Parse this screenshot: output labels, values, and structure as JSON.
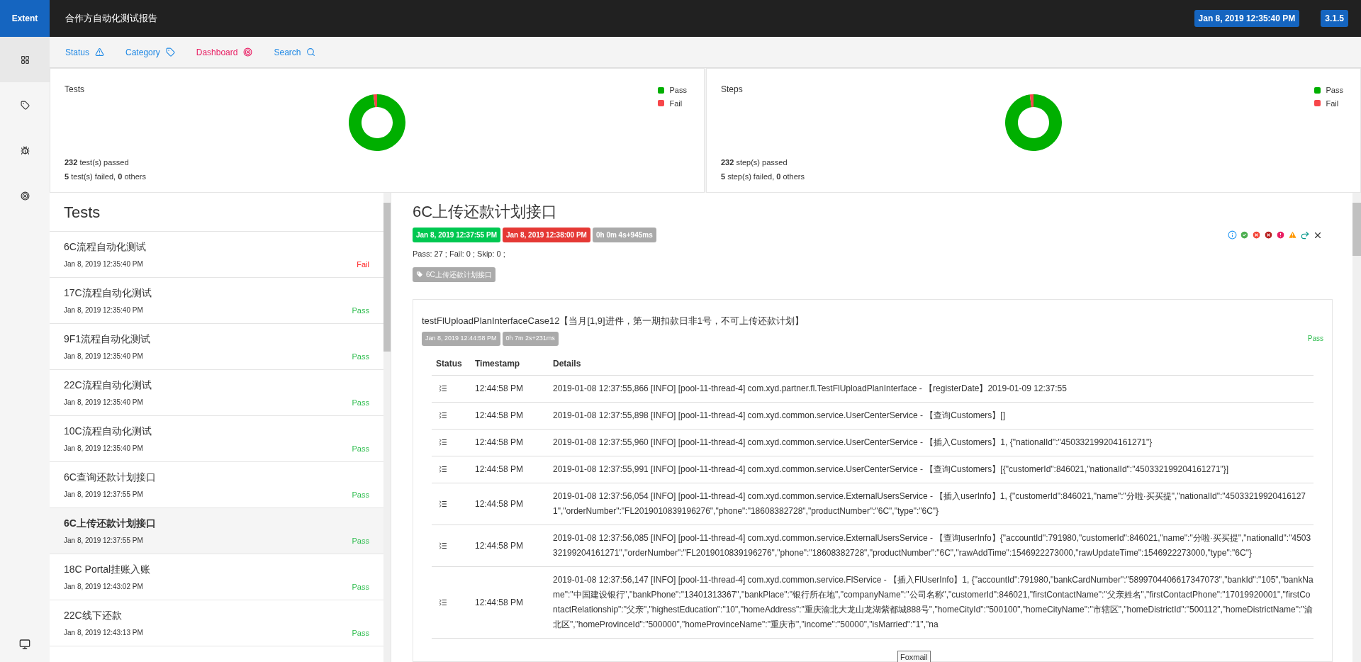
{
  "brand": "Extent",
  "report_title": "合作方自动化测试报告",
  "header_badges": [
    {
      "text": "Jan 8, 2019 12:35:40 PM"
    },
    {
      "text": "3.1.5"
    }
  ],
  "sidebar": {
    "items": [
      {
        "selected": true
      },
      {
        "selected": false
      },
      {
        "selected": false
      },
      {
        "selected": false
      }
    ]
  },
  "nav": [
    {
      "label": "Status",
      "selected": false
    },
    {
      "label": "Category",
      "selected": false
    },
    {
      "label": "Dashboard",
      "selected": true
    },
    {
      "label": "Search",
      "selected": false
    }
  ],
  "summary_cards": [
    {
      "title": "Tests",
      "legend": [
        {
          "label": "Pass",
          "color": "#00af00"
        },
        {
          "label": "Fail",
          "color": "#f7464a"
        }
      ],
      "lines": [
        "**232** test(s) passed",
        "**5** test(s) failed, **0** others"
      ]
    },
    {
      "title": "Steps",
      "legend": [
        {
          "label": "Pass",
          "color": "#00af00"
        },
        {
          "label": "Fail",
          "color": "#f7464a"
        }
      ],
      "lines": [
        "**232** step(s) passed",
        "**5** step(s) failed, **0** others"
      ]
    }
  ],
  "tests": {
    "title": "Tests",
    "items": [
      {
        "name": "6C流程自动化测试",
        "time": "Jan 8, 2019 12:35:40 PM",
        "status": "Fail",
        "kind": "fail",
        "selected": false
      },
      {
        "name": "17C流程自动化测试",
        "time": "Jan 8, 2019 12:35:40 PM",
        "status": "Pass",
        "kind": "pass",
        "selected": false
      },
      {
        "name": "9F1流程自动化测试",
        "time": "Jan 8, 2019 12:35:40 PM",
        "status": "Pass",
        "kind": "pass",
        "selected": false
      },
      {
        "name": "22C流程自动化测试",
        "time": "Jan 8, 2019 12:35:40 PM",
        "status": "Pass",
        "kind": "pass",
        "selected": false
      },
      {
        "name": "10C流程自动化测试",
        "time": "Jan 8, 2019 12:35:40 PM",
        "status": "Pass",
        "kind": "pass",
        "selected": false
      },
      {
        "name": "6C查询还款计划接口",
        "time": "Jan 8, 2019 12:37:55 PM",
        "status": "Pass",
        "kind": "pass",
        "selected": false
      },
      {
        "name": "6C上传还款计划接口",
        "time": "Jan 8, 2019 12:37:55 PM",
        "status": "Pass",
        "kind": "pass",
        "selected": true
      },
      {
        "name": "18C Portal挂账入账",
        "time": "Jan 8, 2019 12:43:02 PM",
        "status": "Pass",
        "kind": "pass",
        "selected": false
      },
      {
        "name": "22C线下还款",
        "time": "Jan 8, 2019 12:43:13 PM",
        "status": "Pass",
        "kind": "pass",
        "selected": false
      }
    ]
  },
  "detail": {
    "title": "6C上传还款计划接口",
    "badges": [
      {
        "text": "Jan 8, 2019 12:37:55 PM",
        "kind": "start"
      },
      {
        "text": "Jan 8, 2019 12:38:00 PM",
        "kind": "end"
      },
      {
        "text": "0h 0m 4s+945ms",
        "kind": "duration"
      }
    ],
    "counts": "Pass: 27 ; Fail: 0 ; Skip: 0 ;",
    "category": "6C上传还款计划接口",
    "node": {
      "title": "testFlUploadPlanInterfaceCase12【当月[1,9]进件，第一期扣款日非1号，不可上传还款计划】",
      "badges": [
        "Jan 8, 2019 12:44:58 PM",
        "0h 7m 2s+231ms"
      ],
      "status": "Pass",
      "kind": "pass",
      "columns": [
        "Status",
        "Timestamp",
        "Details"
      ],
      "rows": [
        {
          "time": "12:44:58 PM",
          "details": "2019-01-08 12:37:55,866 [INFO] [pool-11-thread-4] com.xyd.partner.fl.TestFlUploadPlanInterface - 【registerDate】2019-01-09 12:37:55"
        },
        {
          "time": "12:44:58 PM",
          "details": "2019-01-08 12:37:55,898 [INFO] [pool-11-thread-4] com.xyd.common.service.UserCenterService - 【查询Customers】[]"
        },
        {
          "time": "12:44:58 PM",
          "details": "2019-01-08 12:37:55,960 [INFO] [pool-11-thread-4] com.xyd.common.service.UserCenterService - 【插入Customers】1, {\"nationalId\":\"450332199204161271\"}"
        },
        {
          "time": "12:44:58 PM",
          "details": "2019-01-08 12:37:55,991 [INFO] [pool-11-thread-4] com.xyd.common.service.UserCenterService - 【查询Customers】[{\"customerId\":846021,\"nationalId\":\"450332199204161271\"}]"
        },
        {
          "time": "12:44:58 PM",
          "details": "2019-01-08 12:37:56,054 [INFO] [pool-11-thread-4] com.xyd.common.service.ExternalUsersService - 【插入userInfo】1, {\"customerId\":846021,\"name\":\"分啦·买买提\",\"nationalId\":\"450332199204161271\",\"orderNumber\":\"FL2019010839196276\",\"phone\":\"18608382728\",\"productNumber\":\"6C\",\"type\":\"6C\"}"
        },
        {
          "time": "12:44:58 PM",
          "details": "2019-01-08 12:37:56,085 [INFO] [pool-11-thread-4] com.xyd.common.service.ExternalUsersService - 【查询userInfo】{\"accountId\":791980,\"customerId\":846021,\"name\":\"分啦·买买提\",\"nationalId\":\"450332199204161271\",\"orderNumber\":\"FL2019010839196276\",\"phone\":\"18608382728\",\"productNumber\":\"6C\",\"rawAddTime\":1546922273000,\"rawUpdateTime\":1546922273000,\"type\":\"6C\"}"
        },
        {
          "time": "12:44:58 PM",
          "details": "2019-01-08 12:37:56,147 [INFO] [pool-11-thread-4] com.xyd.common.service.FlService - 【插入FlUserInfo】1, {\"accountId\":791980,\"bankCardNumber\":\"5899704406617347073\",\"bankId\":\"105\",\"bankName\":\"中国建设银行\",\"bankPhone\":\"13401313367\",\"bankPlace\":\"银行所在地\",\"companyName\":\"公司名称\",\"customerId\":846021,\"firstContactName\":\"父亲姓名\",\"firstContactPhone\":\"17019920001\",\"firstContactRelationship\":\"父亲\",\"highestEducation\":\"10\",\"homeAddress\":\"重庆渝北大龙山龙湖紫都城888号\",\"homeCityId\":\"500100\",\"homeCityName\":\"市辖区\",\"homeDistrictId\":\"500112\",\"homeDistrictName\":\"渝北区\",\"homeProvinceId\":\"500000\",\"homeProvinceName\":\"重庆市\",\"income\":\"50000\",\"isMarried\":\"1\",\"na"
        }
      ]
    }
  },
  "tooltip": "Foxmail"
}
